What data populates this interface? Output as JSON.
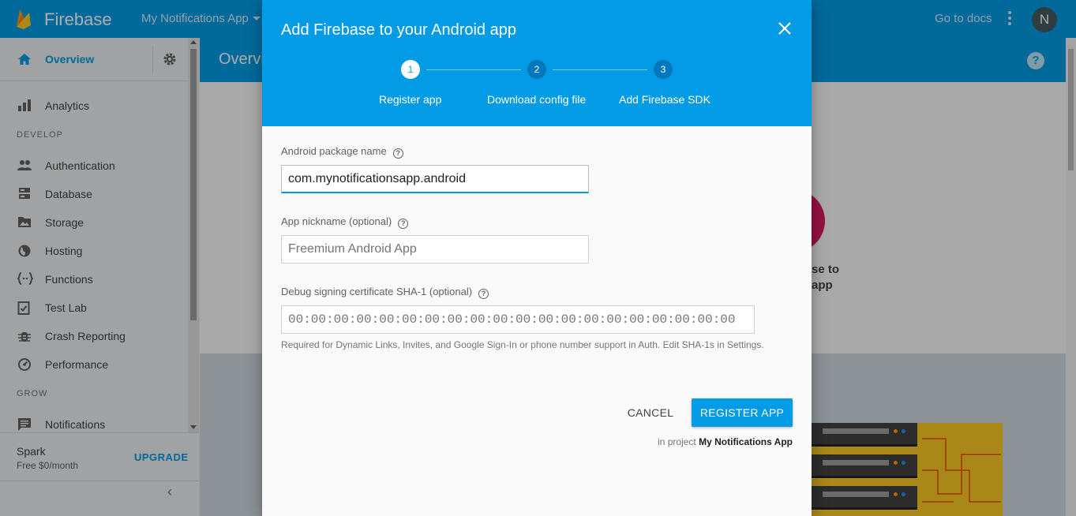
{
  "topbar": {
    "brand": "Firebase",
    "project": "My Notifications App",
    "docs_link": "Go to docs",
    "avatar_initial": "N",
    "brand_color": "#039be5"
  },
  "sidebar": {
    "overview": "Overview",
    "analytics": "Analytics",
    "develop_header": "DEVELOP",
    "develop_items": [
      {
        "label": "Authentication",
        "icon": "people-icon"
      },
      {
        "label": "Database",
        "icon": "database-icon"
      },
      {
        "label": "Storage",
        "icon": "storage-icon"
      },
      {
        "label": "Hosting",
        "icon": "globe-icon"
      },
      {
        "label": "Functions",
        "icon": "functions-icon"
      },
      {
        "label": "Test Lab",
        "icon": "checklist-icon"
      },
      {
        "label": "Crash Reporting",
        "icon": "bug-icon"
      },
      {
        "label": "Performance",
        "icon": "speedometer-icon"
      }
    ],
    "grow_header": "GROW",
    "grow_items": [
      {
        "label": "Notifications",
        "icon": "message-icon"
      }
    ],
    "plan_name": "Spark",
    "plan_price": "Free $0/month",
    "upgrade": "UPGRADE",
    "collapse_glyph": "‹"
  },
  "main": {
    "title": "Overview",
    "bg_text_line1": "se to",
    "bg_text_line2": "app"
  },
  "dialog": {
    "title": "Add Firebase to your Android app",
    "steps": [
      {
        "number": "1",
        "label": "Register app",
        "active": true
      },
      {
        "number": "2",
        "label": "Download config file",
        "active": false
      },
      {
        "number": "3",
        "label": "Add Firebase SDK",
        "active": false
      }
    ],
    "package_label": "Android package name",
    "package_value": "com.mynotificationsapp.android",
    "nickname_label": "App nickname (optional)",
    "nickname_placeholder": "Freemium Android App",
    "sha_label": "Debug signing certificate SHA-1 (optional)",
    "sha_placeholder": "00:00:00:00:00:00:00:00:00:00:00:00:00:00:00:00:00:00:00:00",
    "helper": "Required for Dynamic Links, Invites, and Google Sign-In or phone number support in Auth. Edit SHA-1s in Settings.",
    "cancel": "CANCEL",
    "register": "REGISTER APP",
    "in_project_prefix": "in project",
    "in_project_name": "My Notifications App"
  }
}
